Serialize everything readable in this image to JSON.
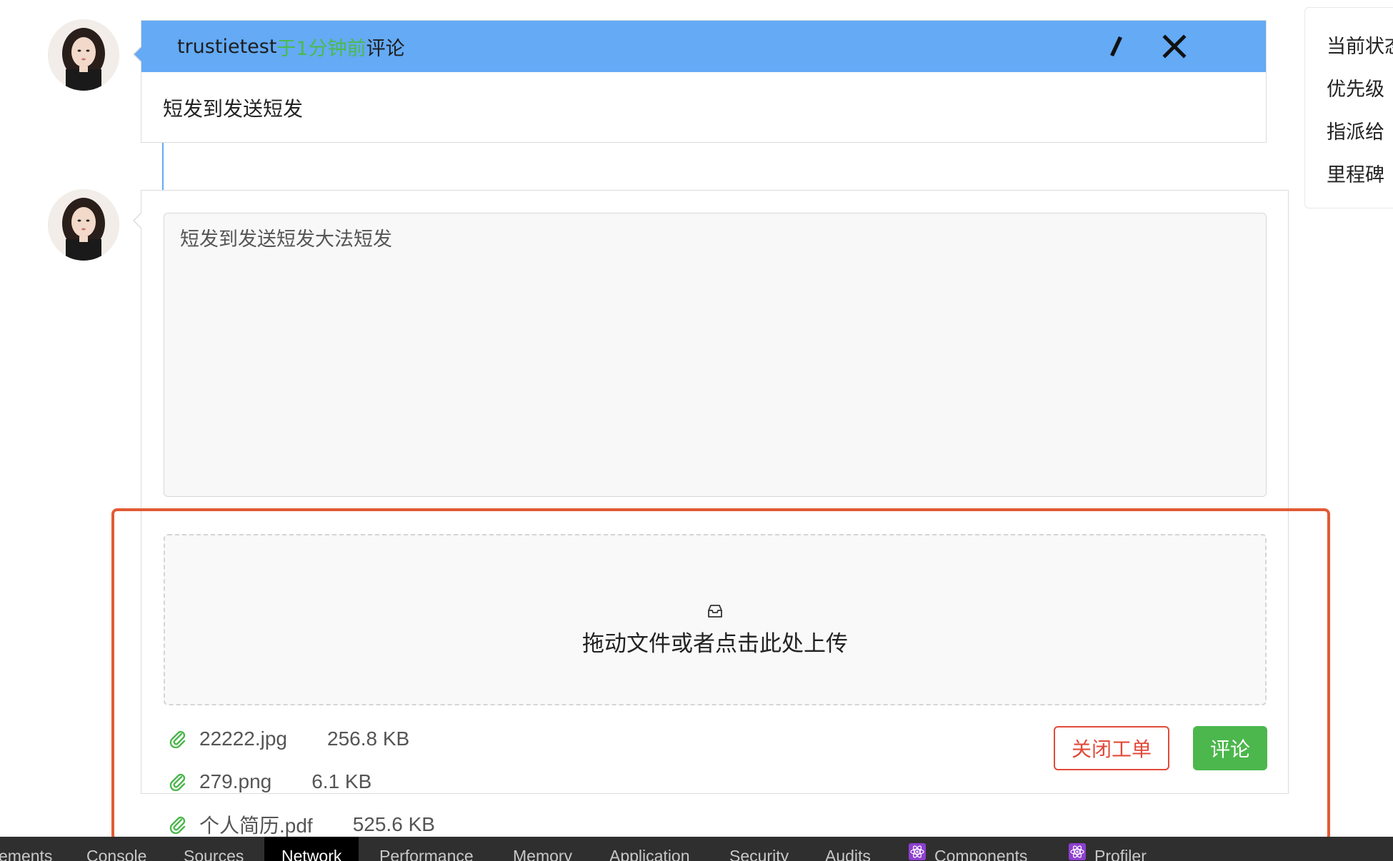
{
  "comment": {
    "author": "trustietest",
    "time": "于1分钟前",
    "verb": "评论",
    "body": "短发到发送短发",
    "edit_icon": "pencil-icon",
    "close_icon": "close-icon"
  },
  "reply": {
    "text": "短发到发送短发大法短发",
    "upload_label": "拖动文件或者点击此处上传",
    "upload_icon": "inbox-icon",
    "files": [
      {
        "name": "22222.jpg",
        "size": "256.8 KB"
      },
      {
        "name": "279.png",
        "size": "6.1 KB"
      },
      {
        "name": "个人简历.pdf",
        "size": "525.6 KB"
      }
    ],
    "close_button": "关闭工单",
    "submit_button": "评论"
  },
  "sidebar": {
    "items": [
      "当前状态",
      "优先级",
      "指派给",
      "里程碑"
    ]
  },
  "devtools": {
    "tabs": [
      "ements",
      "Console",
      "Sources",
      "Network",
      "Performance",
      "Memory",
      "Application",
      "Security",
      "Audits",
      "Components",
      "Profiler"
    ],
    "active": "Network"
  },
  "colors": {
    "header_blue": "#64aaf5",
    "time_green": "#4cba4c",
    "danger_red": "#e24a3a",
    "primary_green": "#4cb74c",
    "highlight": "#e25a34"
  }
}
